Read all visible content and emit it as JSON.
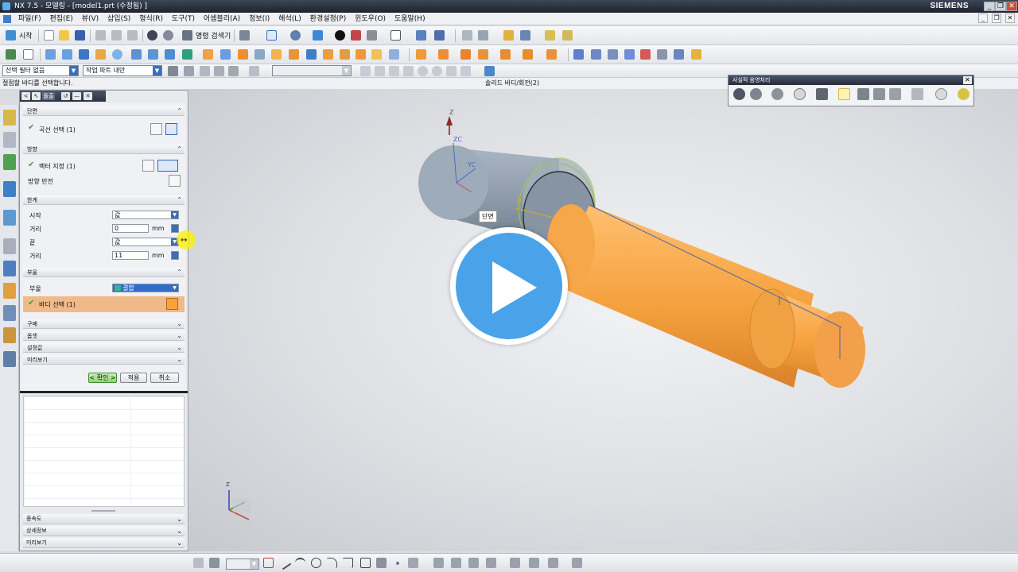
{
  "window": {
    "title": "NX 7.5 - 모델링 - [model1.prt (수정됨) ]",
    "brand": "SIEMENS",
    "controls": [
      "_",
      "❐",
      "✕"
    ]
  },
  "menu": {
    "items": [
      "파일(F)",
      "편집(E)",
      "뷰(V)",
      "삽입(S)",
      "형식(R)",
      "도구(T)",
      "어셈블리(A)",
      "정보(I)",
      "해석(L)",
      "환경설정(P)",
      "윈도우(O)",
      "도움말(H)"
    ],
    "mdi_controls": [
      "_",
      "❐",
      "✕"
    ]
  },
  "toolbar": {
    "start_label": "시작",
    "command_search_label": "명령 검색기"
  },
  "selection_bar": {
    "filter_value": "선택 필터 없음",
    "scope_value": "작업 파트 내만",
    "disabled_value": "",
    "cue_line": "절점할 바디를 선택합니다.",
    "status_line": "솔리드 바디/회전(2)"
  },
  "dialog": {
    "title": "돌출",
    "sections": {
      "section": {
        "header": "단면",
        "select_curve_label": "곡선 선택 (1)"
      },
      "direction": {
        "header": "방향",
        "specify_vector_label": "벡터 지정 (1)",
        "reverse_label": "방향 반전"
      },
      "limits": {
        "header": "한계",
        "start_label": "시작",
        "start_value": "값",
        "start_distance_label": "거리",
        "start_distance_value": "0",
        "end_label": "끝",
        "end_value": "값",
        "end_distance_label": "거리",
        "end_distance_value": "11",
        "unit": "mm"
      },
      "boolean": {
        "header": "부울",
        "boolean_label": "부울",
        "boolean_value": "결합",
        "select_body_label": "바디 선택 (1)"
      },
      "collapsed": [
        "구배",
        "옵셋",
        "설정값",
        "미리보기"
      ]
    },
    "buttons": {
      "ok": "< 확인 >",
      "apply": "적용",
      "cancel": "취소"
    },
    "lower_sections": [
      "종속도",
      "상세정보",
      "미리보기"
    ]
  },
  "viewport": {
    "tooltip": "단면",
    "axis_labels": {
      "z": "Z",
      "zc": "ZC",
      "yc": "YC",
      "triad_z": "Z"
    }
  },
  "render_panel": {
    "title": "사실적 음영처리"
  },
  "colors": {
    "accent_orange": "#f4a040",
    "play_blue": "#4aa3e8",
    "title_dark": "#1c2230"
  },
  "icons": {
    "play": "play-icon"
  }
}
